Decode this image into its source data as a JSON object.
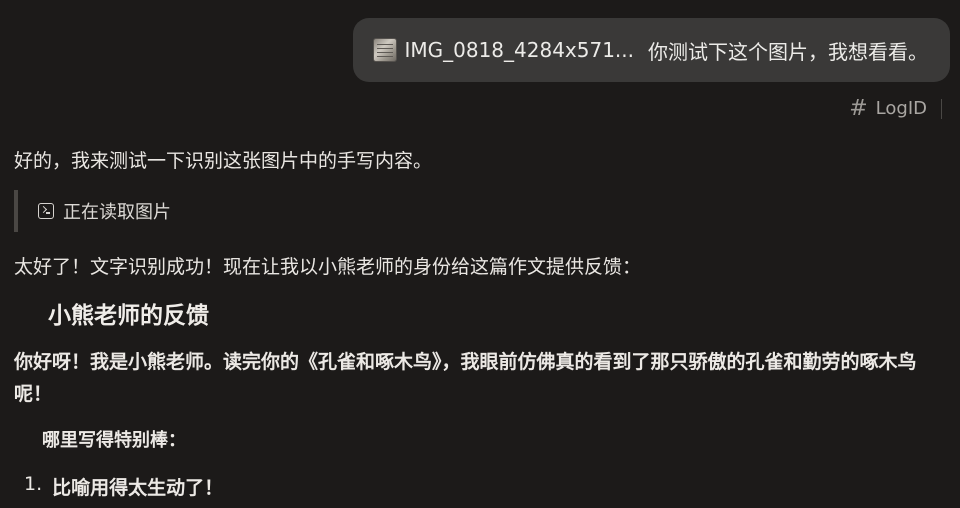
{
  "user_message": {
    "attachment_name": "IMG_0818_4284x571...",
    "text": "你测试下这个图片，我想看看。"
  },
  "logid": {
    "icon": "hash-icon",
    "label": "LogID"
  },
  "assistant": {
    "intro": "好的，我来测试一下识别这张图片中的手写内容。",
    "tool_status": "正在读取图片",
    "after_tool": "太好了！文字识别成功！现在让我以小熊老师的身份给这篇作文提供反馈：",
    "heading": "小熊老师的反馈",
    "paragraph": "你好呀！我是小熊老师。读完你的《孔雀和啄木鸟》，我眼前仿佛真的看到了那只骄傲的孔雀和勤劳的啄木鸟呢！",
    "subheading": "哪里写得特别棒：",
    "list": [
      {
        "num": "1.",
        "text": "比喻用得太生动了！"
      }
    ]
  }
}
